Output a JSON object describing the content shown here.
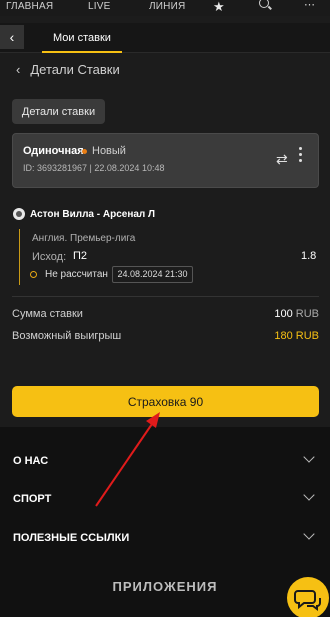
{
  "topnav": {
    "home": "ГЛАВНАЯ",
    "live": "LIVE",
    "line": "ЛИНИЯ"
  },
  "tabs": {
    "my_bets": "Мои ставки"
  },
  "header": {
    "title": "Детали Ставки"
  },
  "details_button": "Детали ставки",
  "bet": {
    "type": "Одиночная",
    "status": "Новый",
    "meta": "ID: 3693281967 | 22.08.2024 10:48",
    "match": "Астон Вилла - Арсенал Л",
    "league": "Англия. Премьер-лига",
    "outcome_label": "Исход:",
    "outcome_value": "П2",
    "odds": "1.8",
    "calc_status": "Не рассчитан",
    "event_date": "24.08.2024 21:30"
  },
  "summary": {
    "stake_label": "Сумма ставки",
    "stake_value": "100",
    "stake_currency": "RUB",
    "win_label": "Возможный выигрыш",
    "win_value": "180",
    "win_currency": "RUB"
  },
  "cta": "Страховка 90",
  "footer": {
    "about": "О НАС",
    "sport": "СПОРТ",
    "links": "ПОЛЕЗНЫЕ ССЫЛКИ",
    "apps": "ПРИЛОЖЕНИЯ"
  },
  "colors": {
    "accent": "#f6c013",
    "status_dot": "#e87d14",
    "arrow": "#e01b1b"
  },
  "icons": [
    "star-icon",
    "search-icon",
    "more-icon",
    "back-icon",
    "chevron-left-icon",
    "repeat-icon",
    "ball-icon",
    "chevron-down-icon",
    "chat-icon"
  ]
}
